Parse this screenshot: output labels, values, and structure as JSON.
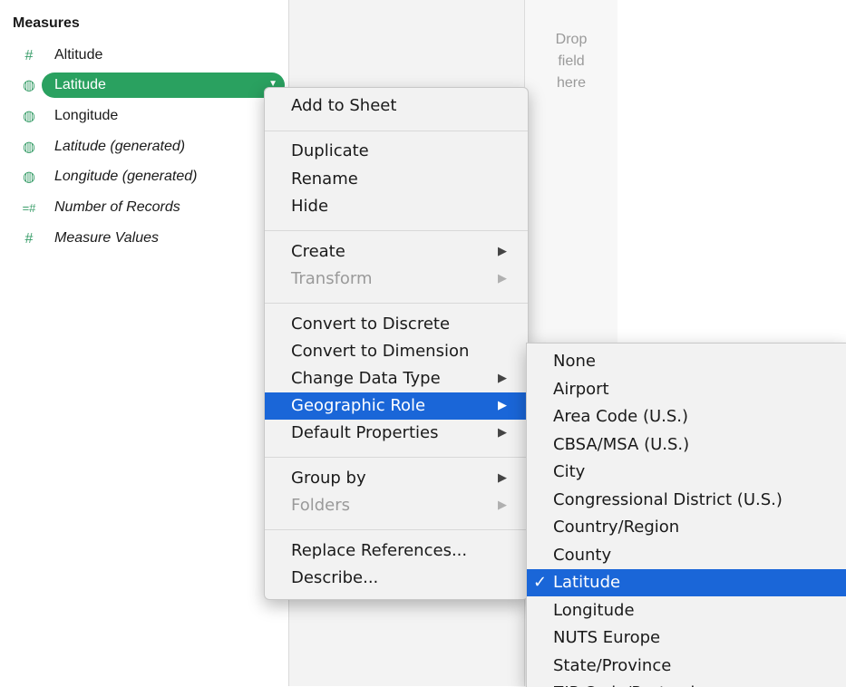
{
  "data_pane": {
    "section_title": "Measures",
    "fields": [
      {
        "icon": "hash-icon",
        "glyph": "#",
        "label": "Altitude",
        "italic": false,
        "selected": false
      },
      {
        "icon": "globe-icon",
        "glyph": "◍",
        "label": "Latitude",
        "italic": false,
        "selected": true
      },
      {
        "icon": "globe-icon",
        "glyph": "◍",
        "label": "Longitude",
        "italic": false,
        "selected": false
      },
      {
        "icon": "globe-icon",
        "glyph": "◍",
        "label": "Latitude (generated)",
        "italic": true,
        "selected": false
      },
      {
        "icon": "globe-icon",
        "glyph": "◍",
        "label": "Longitude (generated)",
        "italic": true,
        "selected": false
      },
      {
        "icon": "calc-hash-icon",
        "glyph": "=#",
        "label": "Number of Records",
        "italic": true,
        "selected": false
      },
      {
        "icon": "hash-icon",
        "glyph": "#",
        "label": "Measure Values",
        "italic": true,
        "selected": false
      }
    ]
  },
  "shelf": {
    "drop_text": "Drop\nfield\nhere"
  },
  "context_menu": {
    "items": [
      {
        "label": "Add to Sheet",
        "has_submenu": false,
        "disabled": false
      },
      {
        "label": "Duplicate",
        "has_submenu": false,
        "disabled": false
      },
      {
        "label": "Rename",
        "has_submenu": false,
        "disabled": false
      },
      {
        "label": "Hide",
        "has_submenu": false,
        "disabled": false
      },
      {
        "label": "Create",
        "has_submenu": true,
        "disabled": false
      },
      {
        "label": "Transform",
        "has_submenu": true,
        "disabled": true
      },
      {
        "label": "Convert to Discrete",
        "has_submenu": false,
        "disabled": false
      },
      {
        "label": "Convert to Dimension",
        "has_submenu": false,
        "disabled": false
      },
      {
        "label": "Change Data Type",
        "has_submenu": true,
        "disabled": false
      },
      {
        "label": "Geographic Role",
        "has_submenu": true,
        "disabled": false,
        "highlighted": true
      },
      {
        "label": "Default Properties",
        "has_submenu": true,
        "disabled": false
      },
      {
        "label": "Group by",
        "has_submenu": true,
        "disabled": false
      },
      {
        "label": "Folders",
        "has_submenu": true,
        "disabled": true
      },
      {
        "label": "Replace References...",
        "has_submenu": false,
        "disabled": false
      },
      {
        "label": "Describe...",
        "has_submenu": false,
        "disabled": false
      }
    ]
  },
  "geographic_role_submenu": {
    "items": [
      {
        "label": "None",
        "checked": false
      },
      {
        "label": "Airport",
        "checked": false
      },
      {
        "label": "Area Code (U.S.)",
        "checked": false
      },
      {
        "label": "CBSA/MSA (U.S.)",
        "checked": false
      },
      {
        "label": "City",
        "checked": false
      },
      {
        "label": "Congressional District (U.S.)",
        "checked": false
      },
      {
        "label": "Country/Region",
        "checked": false
      },
      {
        "label": "County",
        "checked": false
      },
      {
        "label": "Latitude",
        "checked": true
      },
      {
        "label": "Longitude",
        "checked": false
      },
      {
        "label": "NUTS Europe",
        "checked": false
      },
      {
        "label": "State/Province",
        "checked": false
      },
      {
        "label": "ZIP Code/Postcode",
        "checked": false
      }
    ]
  },
  "colors": {
    "field_icon": "#3a9e6a",
    "selected_pill": "#2aa160",
    "menu_highlight": "#1a66d8"
  }
}
